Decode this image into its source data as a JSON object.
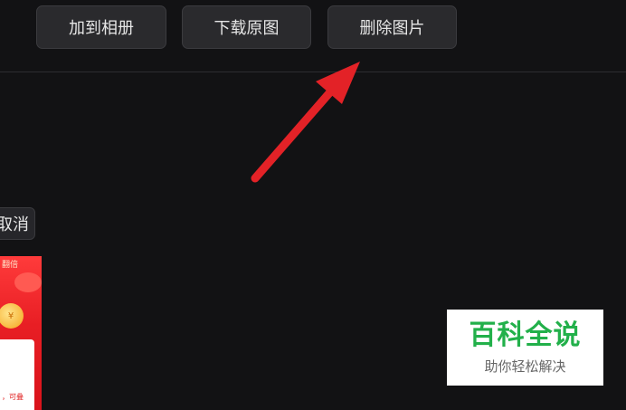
{
  "toolbar": {
    "add_to_album_label": "加到相册",
    "download_original_label": "下载原图",
    "delete_image_label": "删除图片"
  },
  "cancel_label": "取消",
  "thumbnail": {
    "top_label": "翻倍",
    "coin_symbol": "¥",
    "card_text": "，可叠"
  },
  "watermark": {
    "title": "百科全说",
    "subtitle": "助你轻松解决"
  },
  "colors": {
    "background": "#121214",
    "button": "#2a2a2d",
    "arrow": "#e32227",
    "watermark_green": "#22b04a"
  },
  "icons": {
    "annotation_arrow": "red-arrow-icon",
    "coin": "coin-icon"
  }
}
